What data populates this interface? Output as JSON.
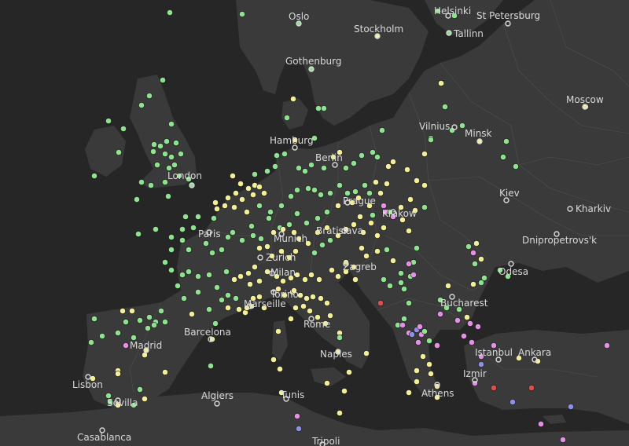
{
  "map": {
    "colors": {
      "sea": "#262626",
      "land": "#3a3a3a",
      "border": "#4a4a4a",
      "label": "#d9d9d9",
      "marker_green": "#8fe28f",
      "marker_yellow": "#f3ee9a",
      "marker_pink": "#e58fe5",
      "marker_blue": "#8f8fe8",
      "marker_red": "#e44d4d"
    },
    "cities": [
      {
        "name": "Oslo"
      },
      {
        "name": "Helsinki"
      },
      {
        "name": "St Petersburg"
      },
      {
        "name": "Stockholm"
      },
      {
        "name": "Tallinn"
      },
      {
        "name": "Gothenburg"
      },
      {
        "name": "Moscow"
      },
      {
        "name": "Vilnius"
      },
      {
        "name": "Minsk"
      },
      {
        "name": "Hamburg"
      },
      {
        "name": "Berlin"
      },
      {
        "name": "London"
      },
      {
        "name": "Kiev"
      },
      {
        "name": "Kharkiv"
      },
      {
        "name": "Prague"
      },
      {
        "name": "Krakow"
      },
      {
        "name": "Paris"
      },
      {
        "name": "Bratislava"
      },
      {
        "name": "Munich"
      },
      {
        "name": "Dnipropetrovs'k"
      },
      {
        "name": "Zurich"
      },
      {
        "name": "Zagreb"
      },
      {
        "name": "Odesa"
      },
      {
        "name": "Milan"
      },
      {
        "name": "Torino"
      },
      {
        "name": "Bucharest"
      },
      {
        "name": "Marseille"
      },
      {
        "name": "Rome"
      },
      {
        "name": "Barcelona"
      },
      {
        "name": "Madrid"
      },
      {
        "name": "Istanbul"
      },
      {
        "name": "Ankara"
      },
      {
        "name": "Naples"
      },
      {
        "name": "Izmir"
      },
      {
        "name": "Lisbon"
      },
      {
        "name": "Athens"
      },
      {
        "name": "Algiers"
      },
      {
        "name": "Sevilla"
      },
      {
        "name": "Tunis"
      },
      {
        "name": "Casablanca"
      },
      {
        "name": "Tripoli"
      }
    ]
  }
}
